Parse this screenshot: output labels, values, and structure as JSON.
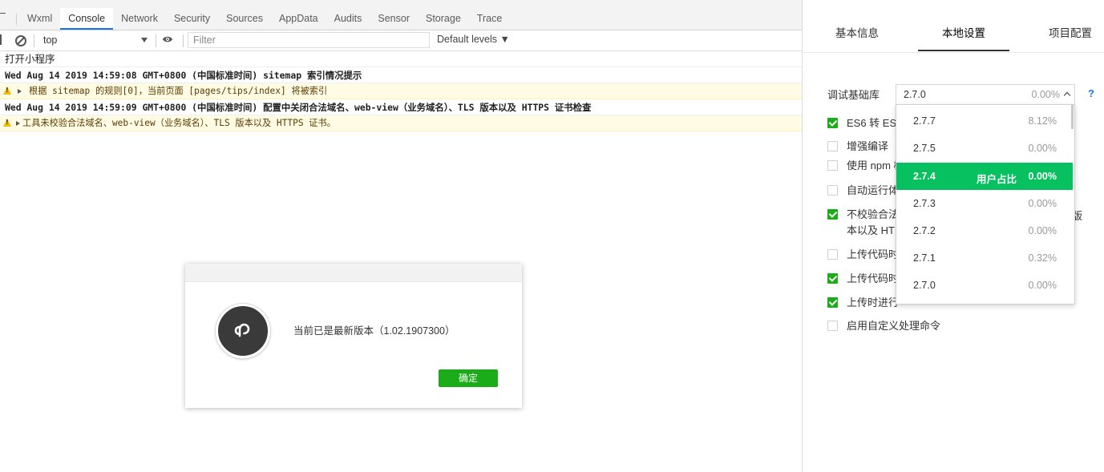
{
  "devtools": {
    "tabs": [
      "Wxml",
      "Console",
      "Network",
      "Security",
      "Sources",
      "AppData",
      "Audits",
      "Sensor",
      "Storage",
      "Trace"
    ],
    "active_tab": "Console",
    "toolbar": {
      "context": "top",
      "filter_placeholder": "Filter",
      "levels": "Default levels ▼"
    },
    "console": {
      "line1": "打开小程序",
      "line2": "Wed Aug 14 2019 14:59:08 GMT+0800 (中国标准时间) sitemap 索引情况提示",
      "line3": "根据 sitemap 的规则[0]，当前页面 [pages/tips/index] 将被索引",
      "line4": "Wed Aug 14 2019 14:59:09 GMT+0800 (中国标准时间) 配置中关闭合法域名、web-view（业务域名）、TLS 版本以及 HTTPS 证书检查",
      "line5": "工具未校验合法域名、web-view（业务域名）、TLS 版本以及 HTTPS 证书。"
    }
  },
  "dialog": {
    "message": "当前已是最新版本（1.02.1907300）",
    "ok_label": "确定"
  },
  "settings": {
    "tabs": {
      "basic": "基本信息",
      "local": "本地设置",
      "project": "项目配置"
    },
    "lib_label": "调试基础库",
    "lib_value": "2.7.0",
    "lib_percent": "0.00%",
    "help": "?",
    "options": {
      "es6": "ES6 转 ES",
      "enhance": "增强编译",
      "npm": "使用 npm 模",
      "autorun": "自动运行体",
      "noverify_l1": "不校验合法",
      "noverify_l2": "本以及 HT",
      "noverify_tail": "版",
      "upload1": "上传代码时",
      "upload2": "上传代码时",
      "upload3": "上传时进行",
      "custom": "启用自定义处理命令"
    },
    "dropdown": [
      {
        "version": "2.7.7",
        "percent": "8.12%"
      },
      {
        "version": "2.7.5",
        "percent": "0.00%"
      },
      {
        "version": "2.7.4",
        "percent": "0.00%",
        "tag": "用户占比"
      },
      {
        "version": "2.7.3",
        "percent": "0.00%"
      },
      {
        "version": "2.7.2",
        "percent": "0.00%"
      },
      {
        "version": "2.7.1",
        "percent": "0.32%"
      },
      {
        "version": "2.7.0",
        "percent": "0.00%"
      }
    ],
    "colors": {
      "accent": "#07c160",
      "check": "#1aad19"
    }
  }
}
